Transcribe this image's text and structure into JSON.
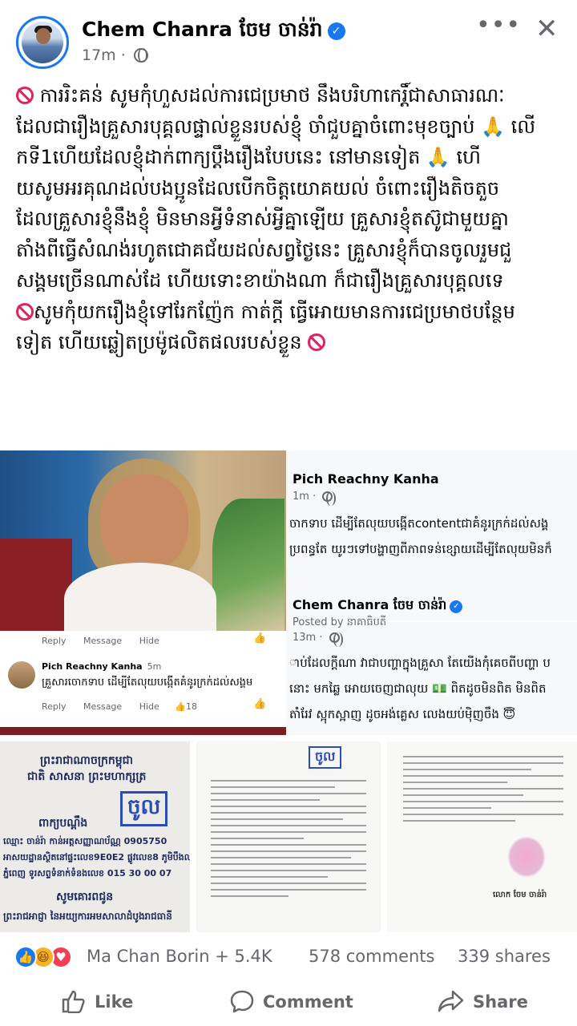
{
  "header": {
    "author": "Chem Chanra ចែម ចាន់រ៉ា",
    "time": "17m",
    "more_label": "•••",
    "close_label": "✕"
  },
  "post": {
    "lines": [
      " ការរិះគន់ សូមកុំហួសដល់ការជេប្រមាថ នឹងបរិហាកេរ្តិ៍ជាសាធារណៈ",
      "ដែលជារឿងគ្រួសារបុគ្គលផ្ទាល់ខ្លួនរបស់ខ្ញុំ ចាំជួបគ្នាចំពោះមុខច្បាប់ 🙏 លើ",
      "កទី1ហើយដែលខ្ញុំដាក់ពាក្យប្ដឹងរឿងបែបនេះ  នៅមានទៀត 🙏 ហើ",
      "យសូមអរគុណដល់បងប្អូនដែលបើកចិត្តយោគយល់ ចំពោះរឿងតិចតួច",
      "ដែលគ្រួសារខ្ញុំនឹងខ្ញុំ  មិនមានអ្វីទំនាស់អ្វីគ្នាឡើយ  គ្រួសារខ្ញុំតស៊ូជាមួយគ្នា",
      "តាំងពីធ្វើសំណង់រហូតជោគជ័យដល់សព្វថ្ងៃនេះ គ្រួសារខ្ញុំក៏បានចូលរួមជួ",
      "សង្គមច្រើនណាស់ដែ ហើយទោះខាយ៉ាងណា ក៏ជារឿងគ្រួសារបុគ្គលទេ",
      "សូមកុំយករឿងខ្ញុំទៅរែកញ៉ែក កាត់ក្តី ធ្វើអោយមានការជេប្រមាថបន្ថែម",
      "ទៀត ហើយឆ្លៀតប្រម៉ូផលិតផលរបស់ខ្លួន "
    ]
  },
  "comment_screenshot": {
    "actions_top": [
      "Reply",
      "Message",
      "Hide"
    ],
    "commenter": "Pich Reachny Kanha",
    "comment_time": "5m",
    "comment_text": "គ្រួសារចោកទាប ដើម្បីតែលុយបង្កើតគំនូរក្រក់ដល់សង្គម",
    "actions_bottom": [
      "Reply",
      "Message",
      "Hide"
    ],
    "like_count": "18"
  },
  "facebook_screenshot": {
    "post1_name": "Pich Reachny Kanha",
    "post1_time": "1m",
    "post1_lines": [
      "ចាកទាប ដើម្បីតែលុយបង្កើតcontentជាគំនូរក្រក់ដល់សង្គ",
      "ប្រពន្ធតែ យូរៗទៅបង្ហាញពីភាពទន់ខ្សោយដើម្បីតែលុយមិនក៏"
    ],
    "post2_name": "Chem Chanra ចែម ចាន់រ៉ា",
    "post2_posted_by": "Posted by នាគាធិបតី",
    "post2_time": "13m",
    "post2_lines": [
      "ាប់ដែលក្តីណា វាជាបញ្ហាក្នុងគ្រួសា តែយើងកុំគេចពីបញ្ហា ប",
      "នោះ មកឆ្លៃ អោយចេញជាលុយ 💵 ពិតដូចមិនពិត មិនពិត",
      "តាំរែវ ស្អុកស្អាញ ដូចអង់គ្លេស លេងយប់ម៉ិញចឹង 😇"
    ]
  },
  "documents": {
    "doc1_lines": [
      "ព្រះរាជាណាចក្រកម្ពុជា",
      "ជាតិ សាសនា ព្រះមហាក្សត្រ",
      "ពាក្យបណ្តឹង",
      "ឈ្មោះ ចាន់រ៉ា កាន់អត្តសញ្ញាណប័ណ្ណ 0905750",
      "អាសយដ្ឋានស្ថិតនៅផ្ទះលេខ9E0E2 ផ្លូវលេខ8 ភូមិបឹងឈូ",
      "ភ្នំពេញ ទូរសព្ទទំនាក់ទំនងលេខ 015 30 00 07",
      "សូមគោរពជូន",
      "ព្រះរាជអាជ្ញា នៃអយ្យការអមសាលាដំបូងរាជធានី"
    ],
    "doc1_stamp": "ចូល",
    "doc2_stamp": "ចូល",
    "doc3_signer": "លោក ចែម ចាន់រ៉ា"
  },
  "reactions": {
    "summary": "Ma Chan Borin + 5.4K",
    "comments": "578 comments",
    "shares": "339 shares"
  },
  "actions": {
    "like": "Like",
    "comment": "Comment",
    "share": "Share"
  },
  "colors": {
    "accent": "#1877f2",
    "ban": "#e0245e",
    "muted": "#65676b"
  }
}
